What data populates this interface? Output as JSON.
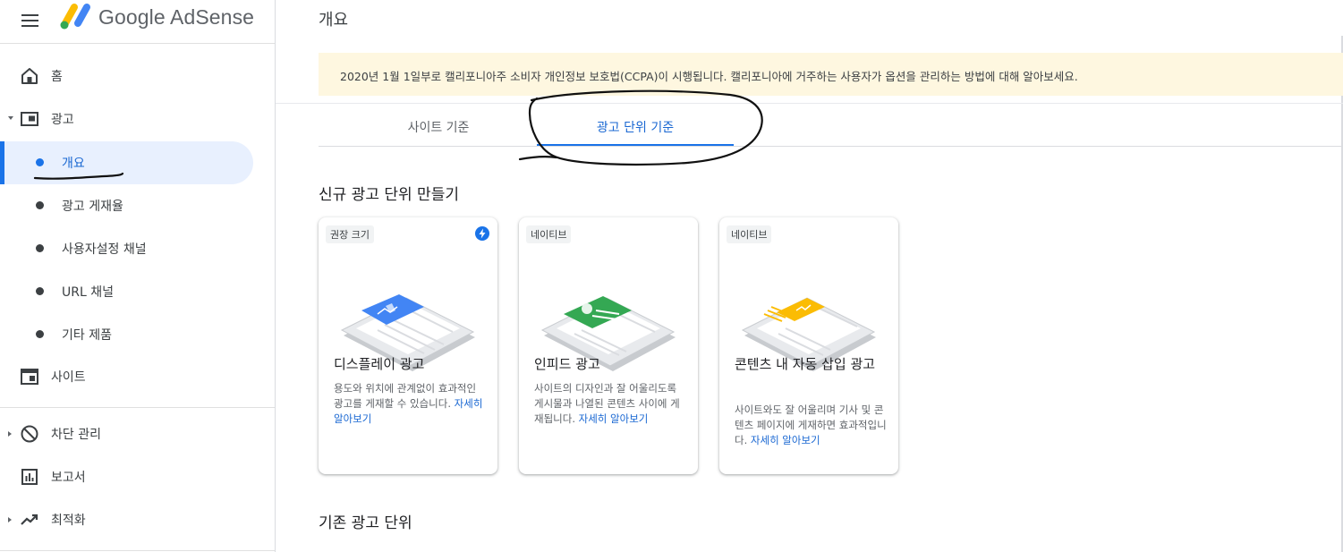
{
  "header": {
    "brand_google": "Google",
    "brand_product": "AdSense",
    "page_title": "개요"
  },
  "sidebar": {
    "home": "홈",
    "ads": "광고",
    "ads_sub": [
      {
        "label": "개요",
        "active": true
      },
      {
        "label": "광고 게재율",
        "active": false
      },
      {
        "label": "사용자설정 채널",
        "active": false
      },
      {
        "label": "URL 채널",
        "active": false
      },
      {
        "label": "기타 제품",
        "active": false
      }
    ],
    "sites": "사이트",
    "block_controls": "차단 관리",
    "reports": "보고서",
    "optimization": "최적화"
  },
  "banner": {
    "text": "2020년 1월 1일부로 캘리포니아주 소비자 개인정보 보호법(CCPA)이 시행됩니다. 캘리포니아에 거주하는 사용자가 옵션을 관리하는 방법에 대해 알아보세요."
  },
  "tabs": [
    {
      "label": "사이트 기준",
      "active": false
    },
    {
      "label": "광고 단위 기준",
      "active": true
    }
  ],
  "sections": {
    "create_title": "신규 광고 단위 만들기",
    "existing_title": "기존 광고 단위"
  },
  "cards": [
    {
      "chip": "권장 크기",
      "title": "디스플레이 광고",
      "desc": "용도와 위치에 관계없이 효과적인 광고를 게재할 수 있습니다.",
      "link": "자세히 알아보기",
      "accent": "#4285f4"
    },
    {
      "chip": "네이티브",
      "title": "인피드 광고",
      "desc": "사이트의 디자인과 잘 어울리도록 게시물과 나열된 콘텐츠 사이에 게재됩니다.",
      "link": "자세히 알아보기",
      "accent": "#34a853"
    },
    {
      "chip": "네이티브",
      "title": "콘텐츠 내 자동 삽입 광고",
      "desc": "사이트와도 잘 어울리며 기사 및 콘텐츠 페이지에 게재하면 효과적입니다.",
      "link": "자세히 알아보기",
      "accent": "#fbbc04"
    }
  ],
  "colors": {
    "primary": "#1a73e8",
    "active_bg": "#e8f0fe",
    "banner_bg": "#fef7e0",
    "text": "#202124",
    "muted": "#5f6368"
  },
  "icons": [
    "menu-icon",
    "adsense-logo-icon",
    "home-icon",
    "ads-icon",
    "sites-icon",
    "block-icon",
    "reports-icon",
    "optimization-icon",
    "lightning-icon"
  ]
}
